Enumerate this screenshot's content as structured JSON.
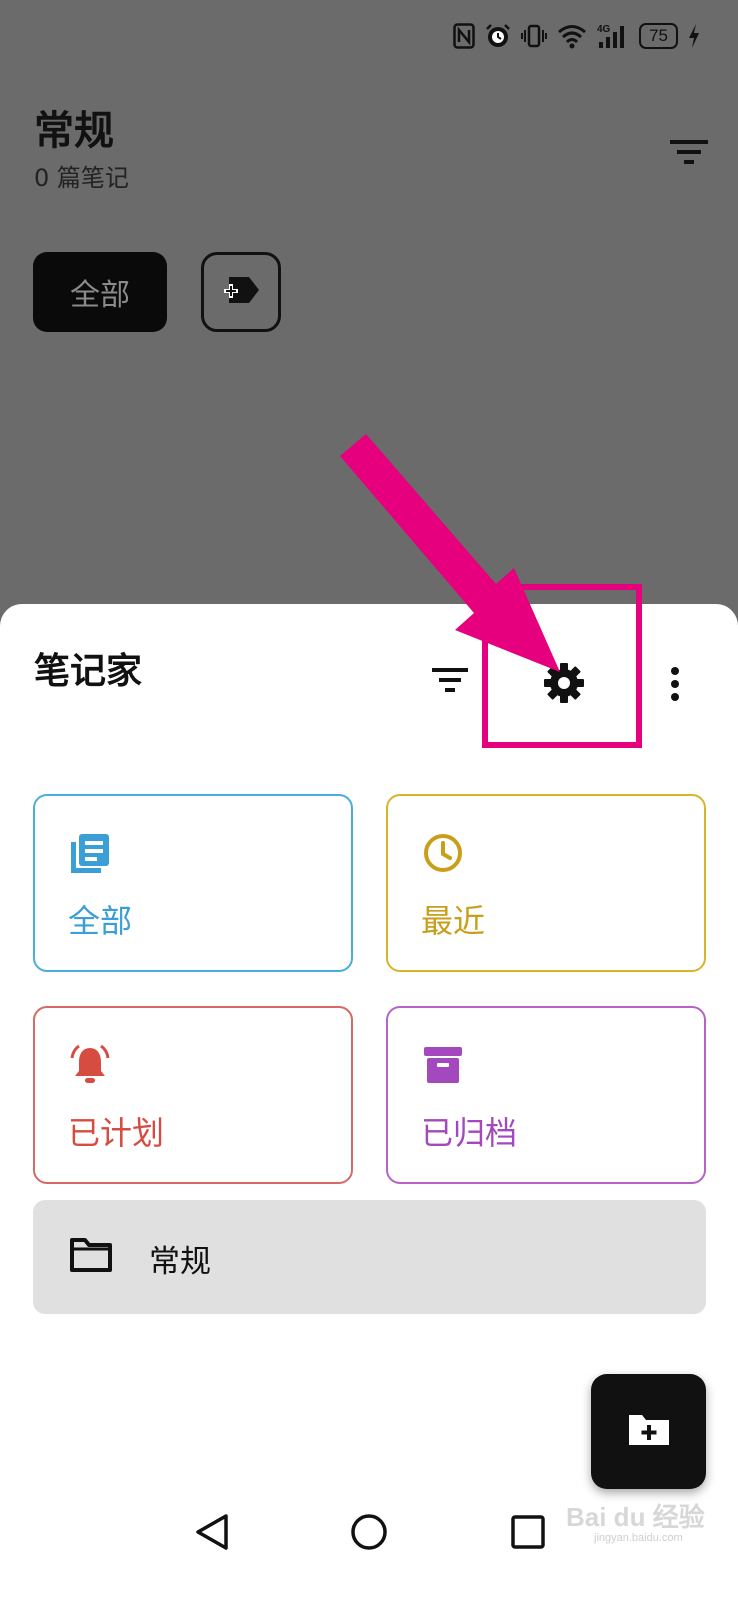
{
  "status_bar": {
    "icons": [
      "nfc-icon",
      "alarm-icon",
      "vibrate-icon",
      "wifi-icon",
      "cellular-4g-icon",
      "battery-icon",
      "charging-icon"
    ],
    "network_label": "4G",
    "battery_level": "75"
  },
  "background_screen": {
    "title": "常规",
    "subtitle": "0 篇笔记",
    "chip_all_label": "全部",
    "chip_add_tag_icon": "tag-add-icon",
    "filter_icon": "filter-icon"
  },
  "sheet": {
    "title": "笔记家",
    "toolbar_icons": [
      "filter-icon",
      "gear-icon",
      "more-vert-icon"
    ],
    "cards": [
      {
        "label": "全部",
        "icon": "notes-list-icon",
        "color": "#3a9fd6"
      },
      {
        "label": "最近",
        "icon": "clock-icon",
        "color": "#c99e1a"
      },
      {
        "label": "已计划",
        "icon": "bell-icon",
        "color": "#d64c40"
      },
      {
        "label": "已归档",
        "icon": "archive-icon",
        "color": "#a448bd"
      }
    ],
    "folder": {
      "label": "常规",
      "icon": "folder-icon"
    },
    "fab_icon": "folder-add-icon"
  },
  "annotation": {
    "color": "#e6007e"
  },
  "nav_bar": {
    "icons": [
      "back-icon",
      "home-icon",
      "recents-icon"
    ]
  },
  "watermark": {
    "text": "Bai du 经验",
    "sub": "jingyan.baidu.com"
  }
}
